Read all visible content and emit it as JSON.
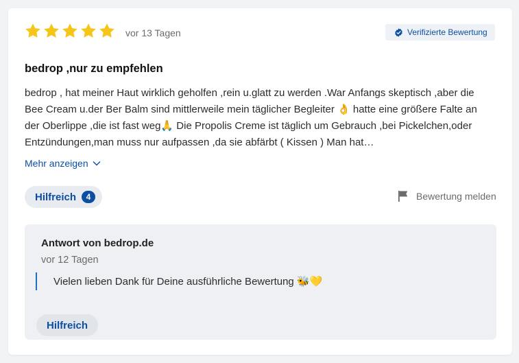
{
  "review": {
    "rating": 5,
    "rating_max": 5,
    "date": "vor 13 Tagen",
    "verified_label": "Verifizierte Bewertung",
    "title": "bedrop ,nur zu empfehlen",
    "body": "bedrop , hat meiner Haut wirklich geholfen ,rein u.glatt zu werden .War Anfangs skeptisch ,aber die Bee Cream u.der Ber Balm sind mittlerweile mein täglicher Begleiter 👌 hatte eine größere Falte an der Oberlippe ,die ist fast weg🙏 Die Propolis Creme ist täglich um Gebrauch ,bei Pickelchen,oder Entzündungen,man muss nur aufpassen ,da sie abfärbt ( Kissen ) Man hat…",
    "more_label": "Mehr anzeigen",
    "helpful_label": "Hilfreich",
    "helpful_count": "4",
    "report_label": "Bewertung melden"
  },
  "reply": {
    "title": "Antwort von bedrop.de",
    "date": "vor 12 Tagen",
    "text": "Vielen lieben Dank für Deine ausführliche Bewertung 🐝💛",
    "helpful_label": "Hilfreich"
  },
  "colors": {
    "star": "#f5c518",
    "accent_blue": "#0b4ea2",
    "background": "#f2f3f5",
    "reply_background": "#eef0f3"
  },
  "icons": {
    "star": "star-icon",
    "verified": "verified-check-icon",
    "chevron": "chevron-down-icon",
    "report": "flag-icon"
  }
}
